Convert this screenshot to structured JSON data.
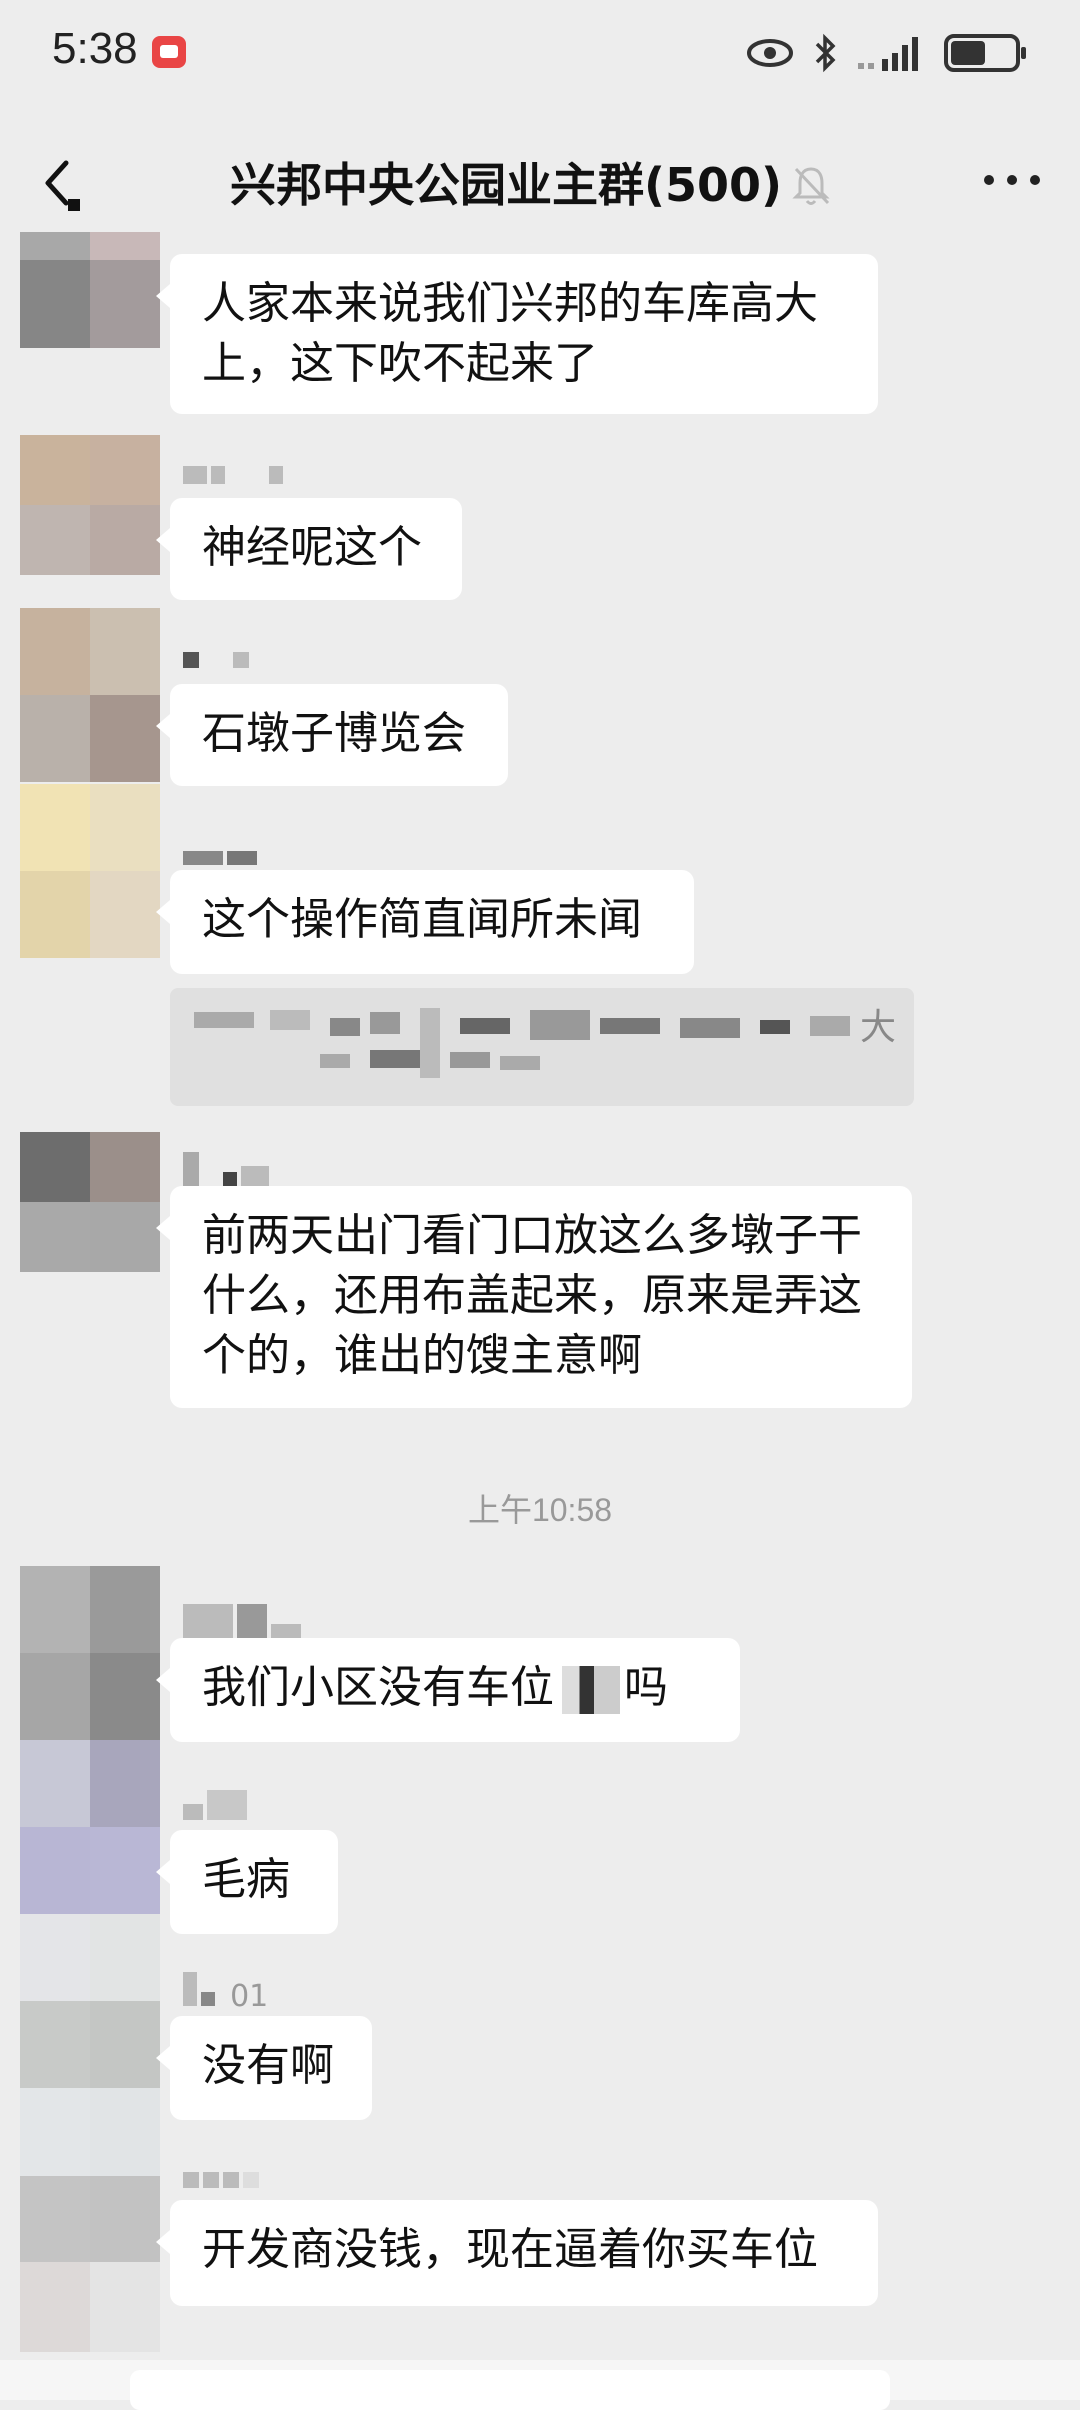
{
  "status_bar": {
    "time": "5:38",
    "icons": [
      "notification-icon",
      "eye-icon",
      "bluetooth-icon",
      "signal-icon",
      "battery-icon"
    ]
  },
  "header": {
    "title": "兴邦中央公园业主群(500)",
    "icons": [
      "back-icon",
      "mute-bell-icon",
      "more-icon"
    ]
  },
  "messages": [
    {
      "text_lines": [
        "人家本来说我们兴邦的车库高大",
        "上，这下吹不起来了"
      ]
    },
    {
      "text_lines": [
        "神经呢这个"
      ]
    },
    {
      "text_lines": [
        "石墩子博览会"
      ]
    },
    {
      "text_lines": [
        "这个操作简直闻所未闻"
      ]
    },
    {
      "quote_visible": "大"
    },
    {
      "text_lines": [
        "前两天出门看门口放这么多墩子干",
        "什么，还用布盖起来，原来是弄这",
        "个的，谁出的馊主意啊"
      ]
    },
    {
      "text_lines": [
        "我们小区没有车位",
        "吗"
      ]
    },
    {
      "text_lines": [
        "毛病"
      ]
    },
    {
      "name_partial": "01",
      "text_lines": [
        "没有啊"
      ]
    },
    {
      "text_lines": [
        "开发商没钱，现在逼着你买车位"
      ]
    }
  ],
  "timestamp": "上午10:58"
}
